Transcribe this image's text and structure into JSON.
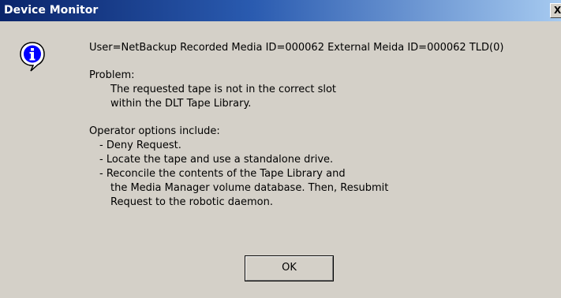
{
  "window": {
    "title": "Device Monitor",
    "close_label": "X"
  },
  "icon": "info-icon",
  "message": {
    "header": "User=NetBackup  Recorded Media ID=000062  External Meida ID=000062  TLD(0)",
    "problem_label": "Problem:",
    "problem_lines": [
      "The requested tape is not in the correct slot",
      "within the DLT Tape Library."
    ],
    "options_label": "Operator options include:",
    "option_1": "- Deny Request.",
    "option_2": "- Locate the tape and use a standalone drive.",
    "option_3_lines": [
      "- Reconcile the contents of the Tape Library and",
      "the Media Manager volume database.  Then, Resubmit",
      "Request to the robotic daemon."
    ]
  },
  "buttons": {
    "ok_label": "OK"
  },
  "colors": {
    "title_bar_start": "#0a246a",
    "title_bar_end": "#a6caf0",
    "dialog_background": "#d4d0c8",
    "icon_fill": "#0000ff"
  }
}
